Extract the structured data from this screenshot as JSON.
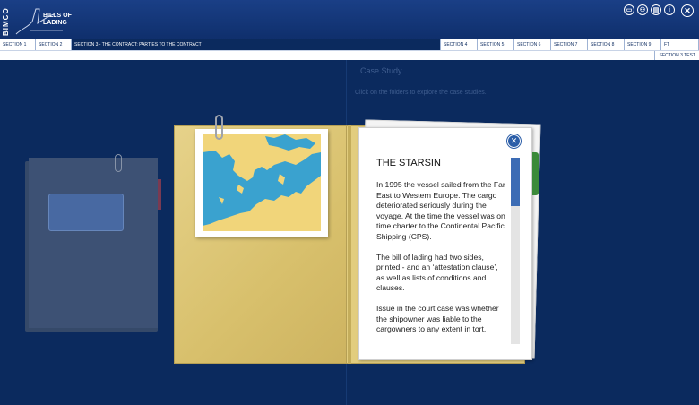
{
  "header": {
    "logo_side": "BIMCO",
    "logo_line1": "BILLS OF",
    "logo_line2": "LADING",
    "icons": [
      "book-icon",
      "people-icon",
      "document-icon",
      "info-icon",
      "close-icon"
    ]
  },
  "nav": {
    "items": [
      {
        "label": "SECTION 1"
      },
      {
        "label": "SECTION 2"
      },
      {
        "label": "SECTION 3 - THE CONTRACT: PARTIES TO THE CONTRACT"
      },
      {
        "label": "SECTION 4"
      },
      {
        "label": "SECTION 5"
      },
      {
        "label": "SECTION 6"
      },
      {
        "label": "SECTION 7"
      },
      {
        "label": "SECTION 8"
      },
      {
        "label": "SECTION 9"
      },
      {
        "label": "FT"
      }
    ],
    "section_test": "SECTION 3 TEST"
  },
  "main": {
    "title": "Case Study",
    "instruction": "Click on the folders to explore the case studies."
  },
  "case": {
    "heading": "THE STARSIN",
    "paragraphs": [
      "In 1995 the vessel sailed from the Far East to Western Europe. The cargo deteriorated seriously during the voyage. At the time the vessel was on time charter to the Continental Pacific Shipping (CPS).",
      "The bill of lading had two sides, printed - and an ‘attestation clause’, as well as lists of conditions and clauses.",
      "Issue in the court case was whether the shipowner was liable to the cargowners to any extent in tort."
    ],
    "close_label": "✕"
  },
  "colors": {
    "background": "#0b2a5e",
    "folder": "#e2cd7e",
    "accent": "#2c5ea8"
  }
}
